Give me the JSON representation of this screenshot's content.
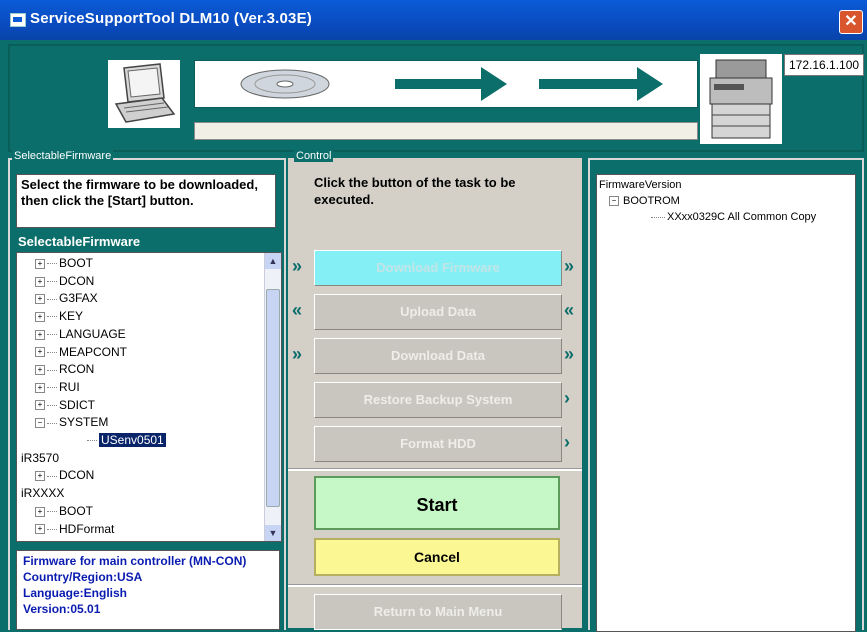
{
  "window": {
    "title": "ServiceSupportTool DLM10 (Ver.3.03E)",
    "close": "✕"
  },
  "banner": {
    "ip_address": "172.16.1.100",
    "colors": {
      "arrow": "#0b6e6a"
    }
  },
  "left": {
    "legend": "SelectableFirmware",
    "instruction": "Select the firmware to be downloaded, then click the [Start] button.",
    "tree_label": "SelectableFirmware",
    "tree": [
      {
        "label": "BOOT",
        "node": "plus"
      },
      {
        "label": "DCON",
        "node": "plus"
      },
      {
        "label": "G3FAX",
        "node": "plus"
      },
      {
        "label": "KEY",
        "node": "plus"
      },
      {
        "label": "LANGUAGE",
        "node": "plus"
      },
      {
        "label": "MEAPCONT",
        "node": "plus"
      },
      {
        "label": "RCON",
        "node": "plus"
      },
      {
        "label": "RUI",
        "node": "plus"
      },
      {
        "label": "SDICT",
        "node": "plus"
      },
      {
        "label": "SYSTEM",
        "node": "minus"
      },
      {
        "label": "USenv0501",
        "node": "child-selected"
      },
      {
        "label": "iR3570",
        "node": "root"
      },
      {
        "label": "DCON",
        "node": "plus"
      },
      {
        "label": "iRXXXX",
        "node": "root"
      },
      {
        "label": "BOOT",
        "node": "plus"
      },
      {
        "label": "HDFormat",
        "node": "plus"
      }
    ],
    "info": [
      "Firmware for main controller (MN-CON)",
      "Country/Region:USA",
      "Language:English",
      "Version:05.01"
    ]
  },
  "control": {
    "legend": "Control",
    "instruction": "Click the button of the task to be executed.",
    "tasks": [
      {
        "label": "Download Firmware",
        "left_arrow": "»",
        "right_arrow": "»",
        "active": true
      },
      {
        "label": "Upload Data",
        "left_arrow": "«",
        "right_arrow": "«",
        "active": false
      },
      {
        "label": "Download Data",
        "left_arrow": "»",
        "right_arrow": "»",
        "active": false
      },
      {
        "label": "Restore Backup System",
        "left_arrow": "",
        "right_arrow": "›",
        "active": false
      },
      {
        "label": "Format HDD",
        "left_arrow": "",
        "right_arrow": "›",
        "active": false
      }
    ],
    "start": "Start",
    "cancel": "Cancel",
    "return": "Return to Main Menu"
  },
  "right": {
    "header": "FirmwareVersion",
    "node": "BOOTROM",
    "child": "XXxx0329C All Common Copy"
  }
}
